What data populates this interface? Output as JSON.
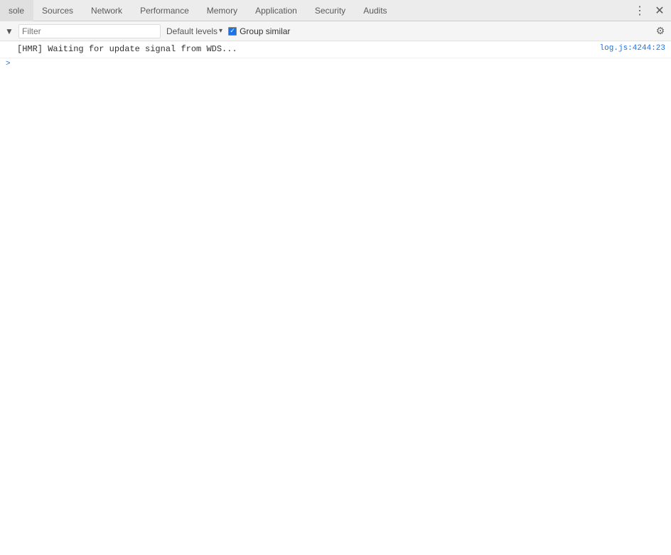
{
  "tabs": {
    "items": [
      {
        "id": "console",
        "label": "sole",
        "active": false,
        "truncated": true
      },
      {
        "id": "sources",
        "label": "Sources",
        "active": false
      },
      {
        "id": "network",
        "label": "Network",
        "active": false
      },
      {
        "id": "performance",
        "label": "Performance",
        "active": false
      },
      {
        "id": "memory",
        "label": "Memory",
        "active": false
      },
      {
        "id": "application",
        "label": "Application",
        "active": false
      },
      {
        "id": "security",
        "label": "Security",
        "active": false
      },
      {
        "id": "audits",
        "label": "Audits",
        "active": false
      }
    ],
    "more_icon": "⋮",
    "close_icon": "✕"
  },
  "toolbar": {
    "expand_icon": "▼",
    "filter_placeholder": "Filter",
    "default_levels_label": "Default levels",
    "group_similar_label": "Group similar",
    "group_similar_checked": true,
    "gear_icon": "⚙"
  },
  "console": {
    "messages": [
      {
        "text": "[HMR] Waiting for update signal from WDS...",
        "link": "log.js:4244:23"
      }
    ],
    "expand_arrow": ">"
  }
}
